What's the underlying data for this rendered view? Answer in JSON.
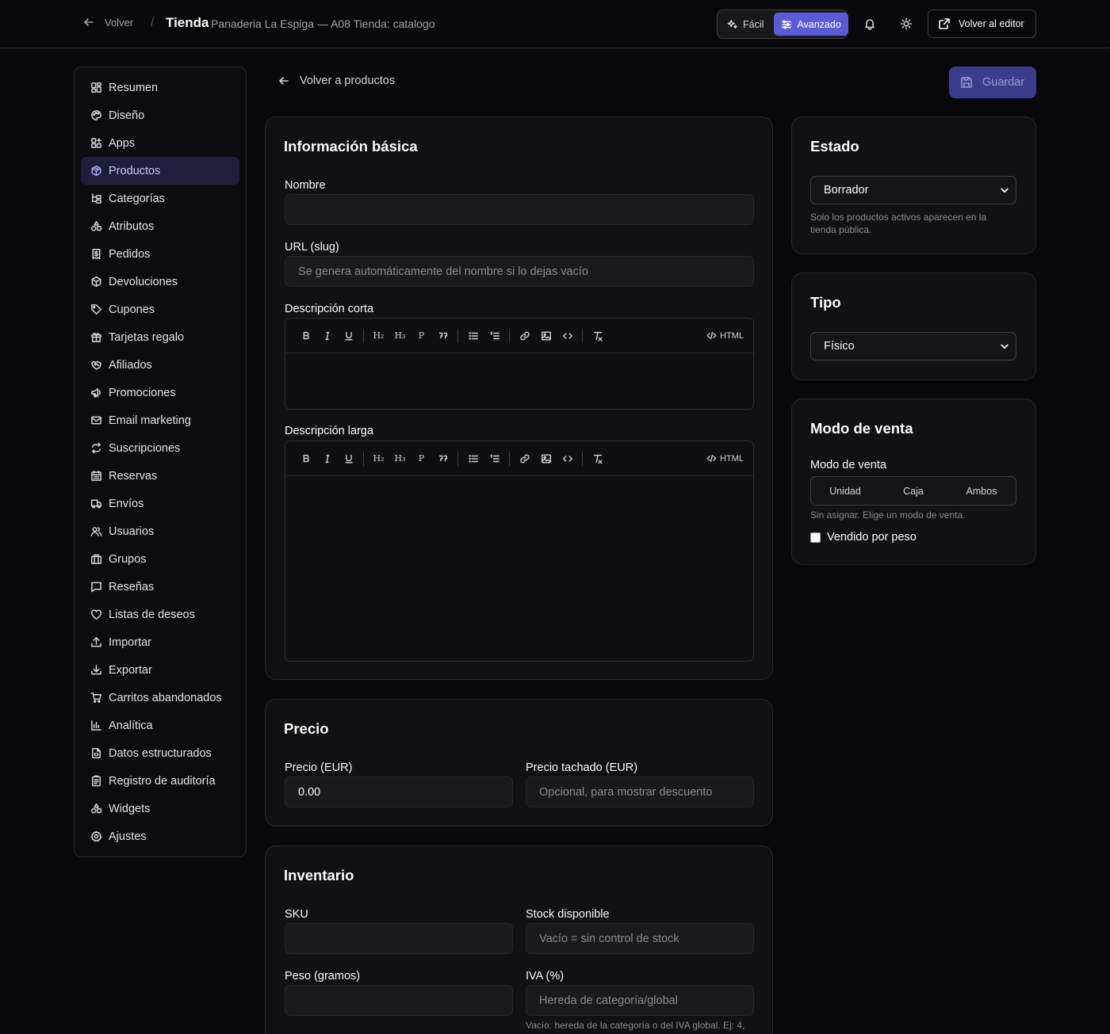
{
  "topbar": {
    "back_label": "Volver",
    "separator": "/",
    "title": "Tienda",
    "subtitle": "Panaderia La Espiga — A08 Tienda: catalogo",
    "mode_easy": "Fácil",
    "mode_advanced": "Avanzado",
    "editor_button": "Volver al editor"
  },
  "sidebar": {
    "items": [
      {
        "label": "Resumen",
        "icon": "dashboard-icon"
      },
      {
        "label": "Diseño",
        "icon": "palette-icon"
      },
      {
        "label": "Apps",
        "icon": "apps-icon"
      },
      {
        "label": "Productos",
        "icon": "package-icon",
        "active": true
      },
      {
        "label": "Categorías",
        "icon": "tree-icon"
      },
      {
        "label": "Atributos",
        "icon": "shapes-icon"
      },
      {
        "label": "Pedidos",
        "icon": "receipt-icon"
      },
      {
        "label": "Devoluciones",
        "icon": "return-package-icon"
      },
      {
        "label": "Cupones",
        "icon": "tag-icon"
      },
      {
        "label": "Tarjetas regalo",
        "icon": "gift-icon"
      },
      {
        "label": "Afiliados",
        "icon": "handshake-icon"
      },
      {
        "label": "Promociones",
        "icon": "megaphone-icon"
      },
      {
        "label": "Email marketing",
        "icon": "mail-icon"
      },
      {
        "label": "Suscripciones",
        "icon": "repeat-icon"
      },
      {
        "label": "Reservas",
        "icon": "calendar-icon"
      },
      {
        "label": "Envíos",
        "icon": "truck-icon"
      },
      {
        "label": "Usuarios",
        "icon": "users-icon"
      },
      {
        "label": "Grupos",
        "icon": "groups-icon"
      },
      {
        "label": "Reseñas",
        "icon": "message-icon"
      },
      {
        "label": "Listas de deseos",
        "icon": "heart-icon"
      },
      {
        "label": "Importar",
        "icon": "upload-icon"
      },
      {
        "label": "Exportar",
        "icon": "download-icon"
      },
      {
        "label": "Carritos abandonados",
        "icon": "cart-icon"
      },
      {
        "label": "Analítica",
        "icon": "bar-chart-icon"
      },
      {
        "label": "Datos estructurados",
        "icon": "file-code-icon"
      },
      {
        "label": "Registro de auditoría",
        "icon": "clipboard-icon"
      },
      {
        "label": "Widgets",
        "icon": "widgets-icon"
      },
      {
        "label": "Ajustes",
        "icon": "gear-icon"
      }
    ]
  },
  "main": {
    "back_to_products": "Volver a productos",
    "save_label": "Guardar"
  },
  "basic": {
    "title": "Información básica",
    "name_label": "Nombre",
    "name_value": "",
    "slug_label": "URL (slug)",
    "slug_placeholder": "Se genera automáticamente del nombre si lo dejas vacío",
    "short_desc_label": "Descripción corta",
    "long_desc_label": "Descripción larga",
    "toolbar": {
      "h2": "H₂",
      "h3": "H₃",
      "p": "P",
      "html": "HTML"
    }
  },
  "price": {
    "title": "Precio",
    "price_label": "Precio (EUR)",
    "price_value": "0.00",
    "compare_label": "Precio tachado (EUR)",
    "compare_placeholder": "Opcional, para mostrar descuento"
  },
  "inventory": {
    "title": "Inventario",
    "sku_label": "SKU",
    "stock_label": "Stock disponible",
    "stock_placeholder": "Vacío = sin control de stock",
    "weight_label": "Peso (gramos)",
    "vat_label": "IVA (%)",
    "vat_placeholder": "Hereda de categoría/global",
    "vat_help": "Vacío: hereda de la categoría o del IVA global. Ej: 4,"
  },
  "status": {
    "title": "Estado",
    "value": "Borrador",
    "help": "Solo los productos activos aparecen en la tienda pública."
  },
  "type": {
    "title": "Tipo",
    "value": "Físico"
  },
  "sale_mode": {
    "title": "Modo de venta",
    "label": "Modo de venta",
    "options": [
      "Unidad",
      "Caja",
      "Ambos"
    ],
    "help": "Sin asignar. Elige un modo de venta.",
    "by_weight_label": "Vendido por peso",
    "by_weight_checked": false
  },
  "colors": {
    "background": "#09090b",
    "card": "#111113",
    "accent": "#5b5bd6",
    "active_nav": "#1e1e3a"
  }
}
